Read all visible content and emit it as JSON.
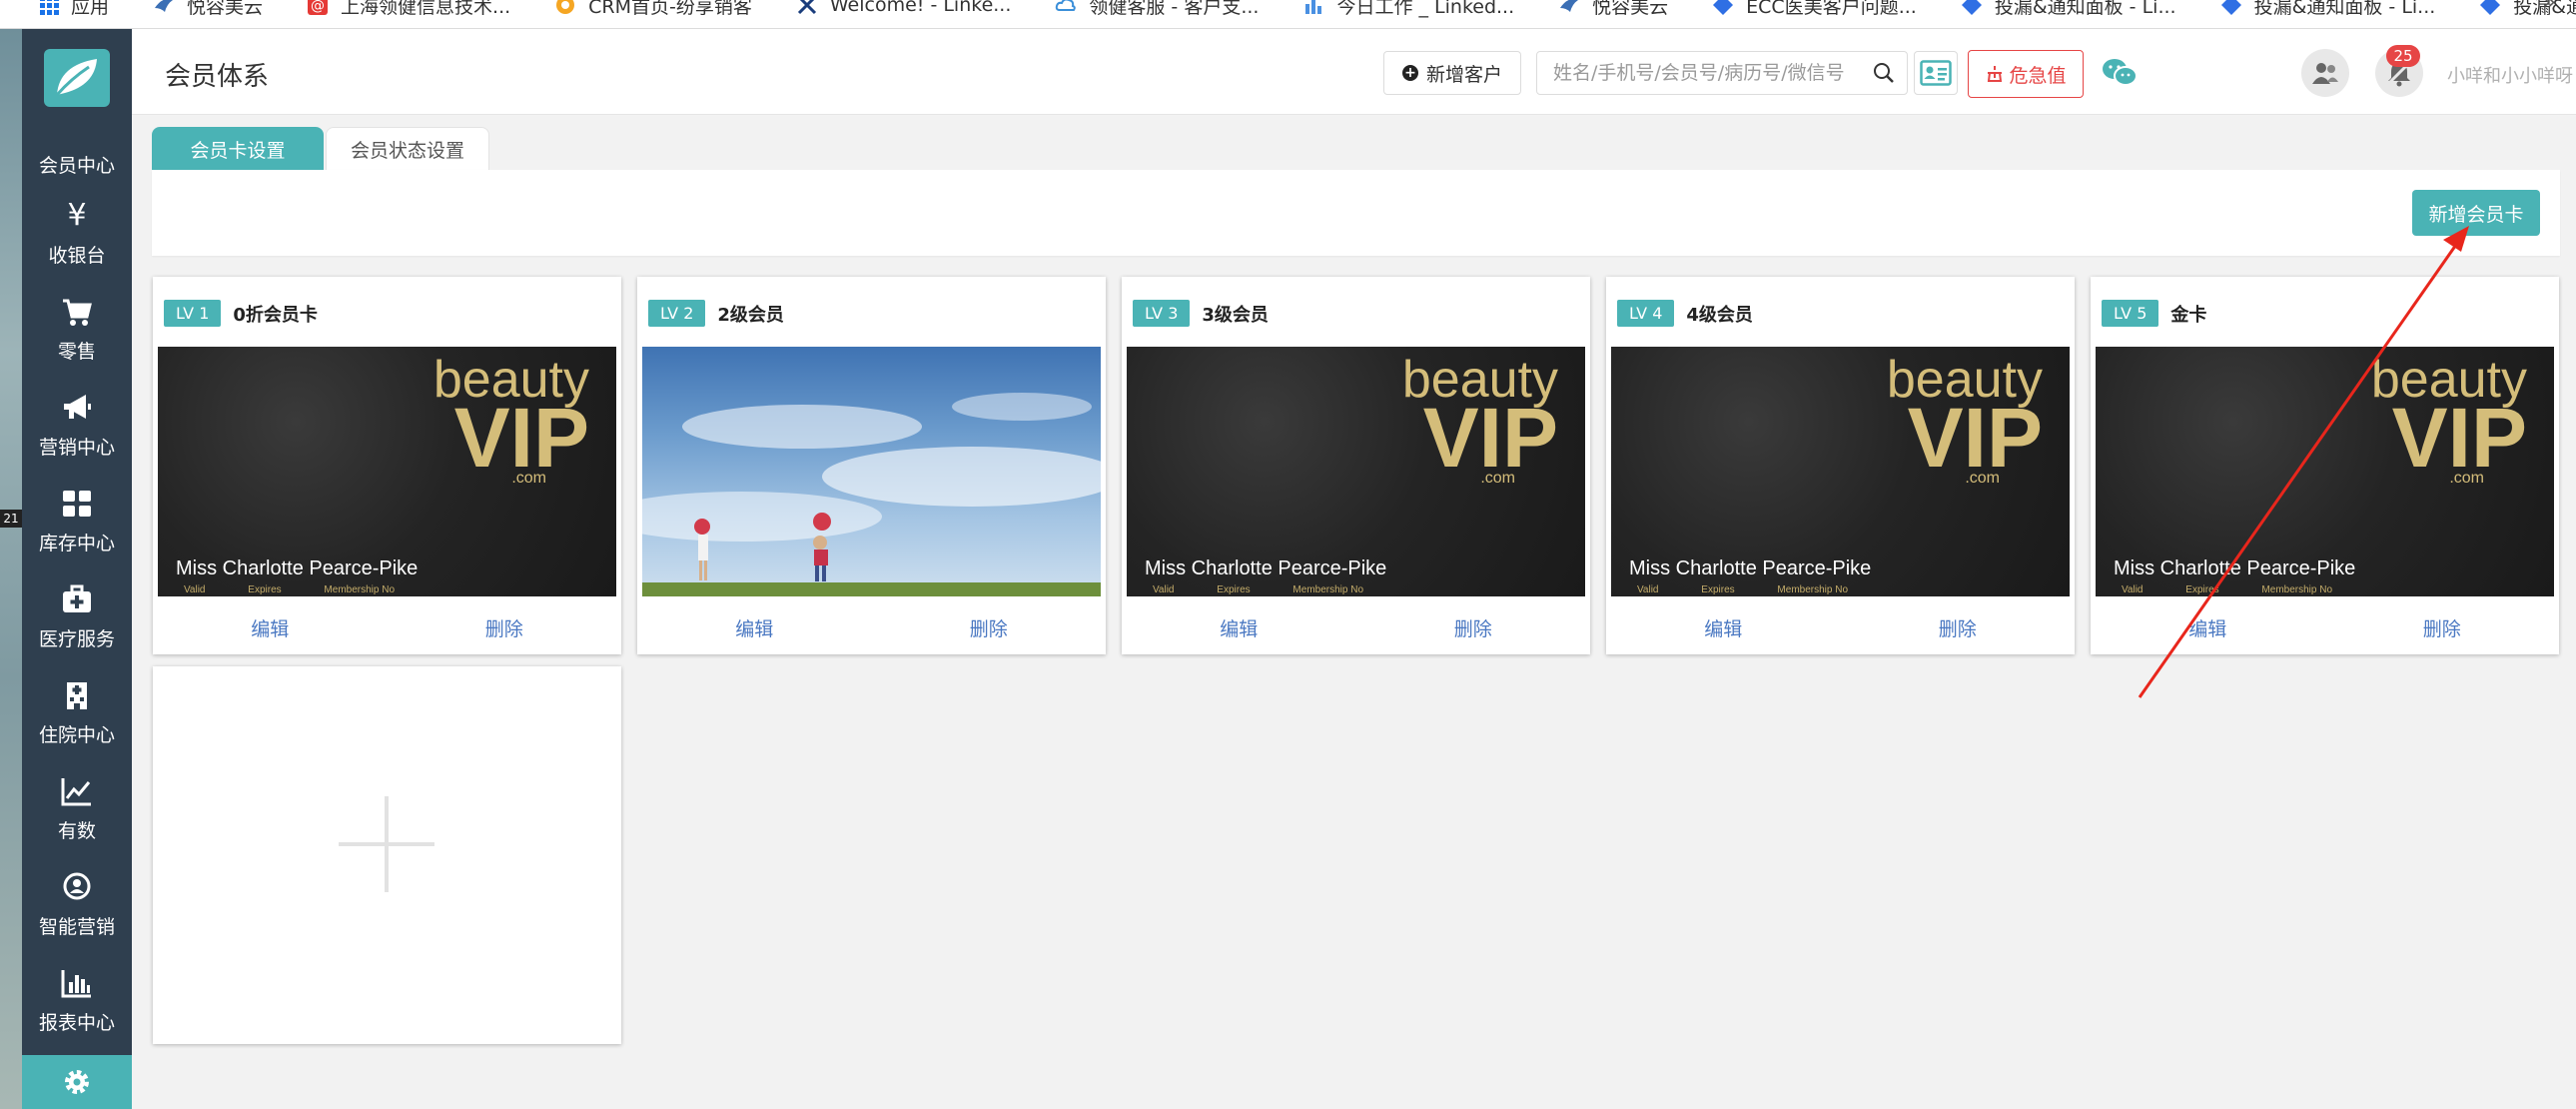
{
  "bookmarks": [
    {
      "label": "应用",
      "icon": "apps-grid-icon"
    },
    {
      "label": "悦容美云",
      "icon": "bird-icon"
    },
    {
      "label": "上海领健信息技术...",
      "icon": "at-icon"
    },
    {
      "label": "CRM首页-纷享销客",
      "icon": "crm-icon"
    },
    {
      "label": "Welcome! - Linke...",
      "icon": "scissors-icon"
    },
    {
      "label": "领健客服 - 客户支...",
      "icon": "cloud-icon"
    },
    {
      "label": "今日工作 _ Linked...",
      "icon": "chart-icon"
    },
    {
      "label": "悦容美云",
      "icon": "bird-icon"
    },
    {
      "label": "ECC医美客户问题...",
      "icon": "diamond-icon"
    },
    {
      "label": "投漏&通知面板 - Li...",
      "icon": "diamond-icon"
    },
    {
      "label": "投漏&通知面板 - Li...",
      "icon": "diamond-icon"
    },
    {
      "label": "投漏&通知面板 - Li...",
      "icon": "diamond-icon"
    }
  ],
  "bookmarks_more": "»",
  "desktop_label": "21",
  "sidebar": {
    "items": [
      {
        "label": "会员中心",
        "icon": "member-icon"
      },
      {
        "label": "收银台",
        "icon": "yen-icon",
        "glyph": "¥"
      },
      {
        "label": "零售",
        "icon": "cart-icon"
      },
      {
        "label": "营销中心",
        "icon": "megaphone-icon"
      },
      {
        "label": "库存中心",
        "icon": "grid-icon"
      },
      {
        "label": "医疗服务",
        "icon": "medkit-icon"
      },
      {
        "label": "住院中心",
        "icon": "hospital-icon"
      },
      {
        "label": "有数",
        "icon": "line-chart-icon"
      },
      {
        "label": "智能营销",
        "icon": "smart-marketing-icon"
      },
      {
        "label": "报表中心",
        "icon": "bar-chart-icon"
      },
      {
        "label": "",
        "icon": "gear-icon"
      }
    ]
  },
  "header": {
    "title": "会员体系",
    "add_customer_label": "新增客户",
    "search_placeholder": "姓名/手机号/会员号/病历号/微信号",
    "danger_label": "危急值",
    "notification_count": "25",
    "user_name": "小咩和小小咩呀 (张江门诊部)"
  },
  "tabs": [
    {
      "label": "会员卡设置",
      "active": true
    },
    {
      "label": "会员状态设置",
      "active": false
    }
  ],
  "toolbar": {
    "new_card_label": "新增会员卡"
  },
  "cards": [
    {
      "level": "LV 1",
      "name": "0折会员卡",
      "image": "beauty-vip",
      "edit": "编辑",
      "delete": "删除"
    },
    {
      "level": "LV 2",
      "name": "2级会员",
      "image": "sky-photo",
      "edit": "编辑",
      "delete": "删除"
    },
    {
      "level": "LV 3",
      "name": "3级会员",
      "image": "beauty-vip",
      "edit": "编辑",
      "delete": "删除"
    },
    {
      "level": "LV 4",
      "name": "4级会员",
      "image": "beauty-vip",
      "edit": "编辑",
      "delete": "删除"
    },
    {
      "level": "LV 5",
      "name": "金卡",
      "image": "beauty-vip",
      "edit": "编辑",
      "delete": "删除"
    }
  ],
  "vip_card": {
    "logo_word_1": "beauty",
    "logo_word_2": "VIP",
    "logo_word_3": ".com",
    "holder": "Miss Charlotte Pearce-Pike",
    "field_valid": "Valid",
    "field_expires": "Expires",
    "field_membership": "Membership No"
  },
  "colors": {
    "accent": "#4ab3b5",
    "sidebar_bg": "#2f3f4f",
    "danger": "#e64545",
    "link": "#4a78c2",
    "gold": "#d4bd7a",
    "annotation_arrow": "#e8261c"
  }
}
